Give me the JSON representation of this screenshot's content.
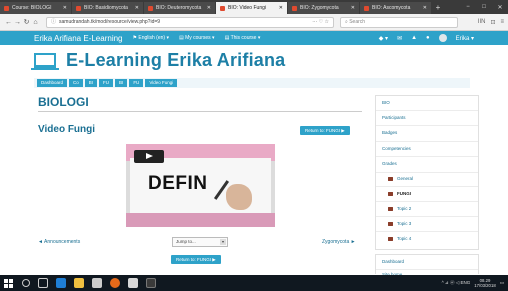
{
  "browser": {
    "tabs": [
      {
        "title": "Course: BIOLOGI",
        "active": false
      },
      {
        "title": "BIO: Basidiomycota",
        "active": false
      },
      {
        "title": "BIO: Deuteromycota",
        "active": false
      },
      {
        "title": "BIO: Video Fungi",
        "active": true
      },
      {
        "title": "BIO: Zygomycota",
        "active": false
      },
      {
        "title": "BIO: Ascomycota",
        "active": false
      }
    ],
    "new_tab": "+",
    "window_controls": [
      "−",
      "□",
      "✕"
    ],
    "url": "samudrandah.tk/mod/resource/view.php?id=9",
    "url_more": "··· ♡ ☆",
    "search_placeholder": "Search",
    "tool_icons": [
      "IIN",
      "⊡",
      "≡"
    ]
  },
  "navbar": {
    "brand": "Erika Arifiana E-Learning",
    "language": "English (en) ▾",
    "my_courses": "My courses ▾",
    "this_course": "This course ▾",
    "right_icons": [
      "◆ ▾",
      "✉",
      "▲",
      "●"
    ],
    "user_menu": "Erika ▾"
  },
  "header": {
    "site_title": "E-Learning Erika Arifiana"
  },
  "breadcrumb": [
    "Dashboard",
    "Co",
    "BI",
    "FU",
    "BI",
    "FU",
    "Video Fungi"
  ],
  "main": {
    "course_title": "BIOLOGI",
    "page_title": "Video Fungi",
    "return_top": "Return to: FUNGI ▶",
    "video_word": "DEFIN",
    "prev_link": "◄ Announcements",
    "jump_placeholder": "Jump to...",
    "jump_arrow": "▾",
    "next_link": "Zygomycota ►",
    "return_bottom": "Return to: FUNGI ▶"
  },
  "sidebar": {
    "title": "BIO",
    "items": [
      "Participants",
      "Badges",
      "Competencies",
      "Grades"
    ],
    "sections": [
      {
        "label": "General",
        "bold": false
      },
      {
        "label": "FUNGI",
        "bold": true
      },
      {
        "label": "Topic 2",
        "bold": false
      },
      {
        "label": "Topic 3",
        "bold": false
      },
      {
        "label": "Topic 4",
        "bold": false
      }
    ],
    "dashboard": "Dashboard",
    "site_home": "Site home"
  },
  "taskbar": {
    "tray_text": "^ ⊿ ⓦ ◁ ENG",
    "time": "08.29",
    "date": "17/03/2018"
  },
  "colors": {
    "brand_blue": "#2ea2c9",
    "title_blue": "#1a6f92",
    "folder_brown": "#8a3d2a",
    "tab_dark": "#3a3a3a",
    "taskbar": "#101820"
  }
}
